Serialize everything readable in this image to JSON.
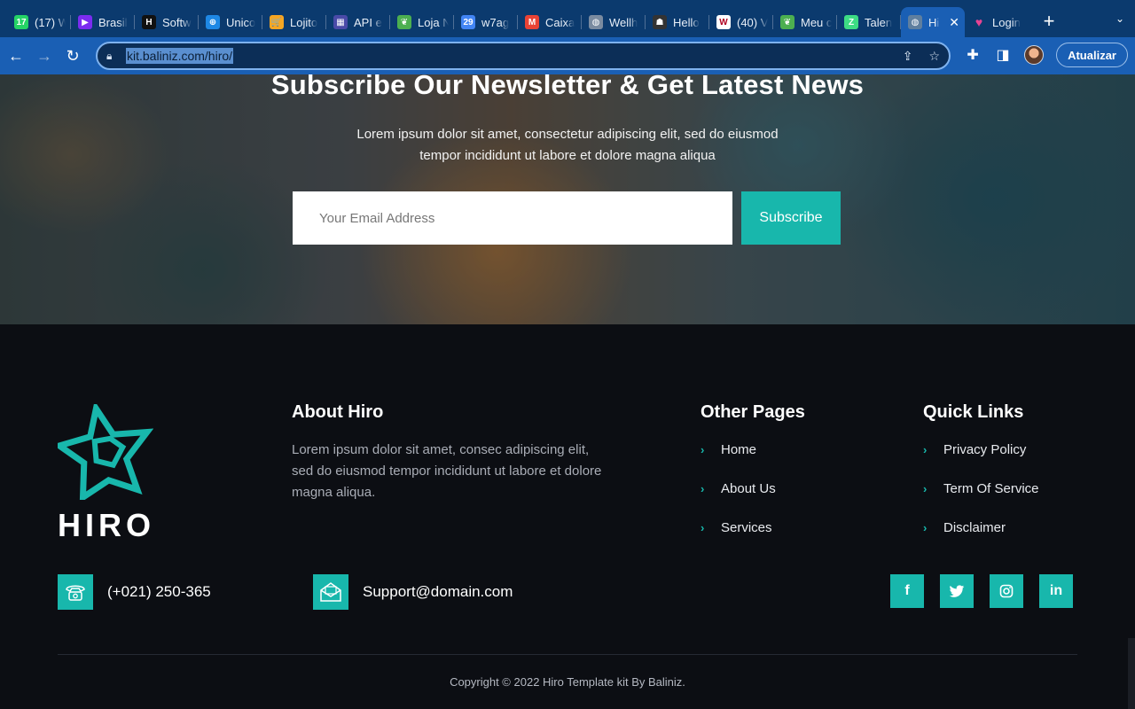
{
  "browser": {
    "tabs": [
      {
        "title": "(17) W",
        "icon": "whatsapp-icon",
        "color": "#25d366",
        "glyph": "17"
      },
      {
        "title": "Brasil",
        "icon": "play-arrow-icon",
        "color": "#7b2cf0",
        "glyph": "▶"
      },
      {
        "title": "Softw",
        "icon": "h-logo-icon",
        "color": "#111111",
        "glyph": "H"
      },
      {
        "title": "Unico",
        "icon": "target-icon",
        "color": "#1e88e5",
        "glyph": "⊕"
      },
      {
        "title": "Lojito",
        "icon": "cart-icon",
        "color": "#f5a623",
        "glyph": "🛒"
      },
      {
        "title": "API e",
        "icon": "city-icon",
        "color": "#4a4aa8",
        "glyph": "▦"
      },
      {
        "title": "Loja N",
        "icon": "leaf-icon",
        "color": "#4caf50",
        "glyph": "❦"
      },
      {
        "title": "w7ag",
        "icon": "calendar-icon",
        "color": "#4285f4",
        "glyph": "29"
      },
      {
        "title": "Caixa",
        "icon": "gmail-icon",
        "color": "#ea4335",
        "glyph": "M"
      },
      {
        "title": "Wellh",
        "icon": "globe-icon",
        "color": "#7a8ba0",
        "glyph": "◍"
      },
      {
        "title": "Hello",
        "icon": "person-icon",
        "color": "#333333",
        "glyph": "☗"
      },
      {
        "title": "(40) V",
        "icon": "w-logo-icon",
        "color": "#ffffff",
        "glyph": "W"
      },
      {
        "title": "Meu c",
        "icon": "leaf-icon",
        "color": "#4caf50",
        "glyph": "❦"
      },
      {
        "title": "Talen",
        "icon": "z-logo-icon",
        "color": "#3ddc84",
        "glyph": "Z"
      }
    ],
    "active_tab": {
      "title": "Hi",
      "icon": "globe-icon",
      "close": "✕"
    },
    "login_tab": {
      "title": "Login",
      "icon": "heart-icon",
      "color": "#e84393"
    },
    "new_tab": "+",
    "url": "kit.baliniz.com/hiro/",
    "update_label": "Atualizar"
  },
  "newsletter": {
    "title": "Subscribe Our Newsletter & Get Latest News",
    "text": "Lorem ipsum dolor sit amet, consectetur adipiscing elit, sed do eiusmod tempor incididunt ut labore et dolore magna aliqua",
    "email_placeholder": "Your Email Address",
    "subscribe_label": "Subscribe"
  },
  "footer": {
    "logo_text": "HIRO",
    "about": {
      "title": "About Hiro",
      "text": "Lorem ipsum dolor sit amet, consec adipiscing elit, sed do eiusmod tempor incididunt ut labore et dolore magna aliqua."
    },
    "other_pages": {
      "title": "Other Pages",
      "items": [
        "Home",
        "About Us",
        "Services"
      ]
    },
    "quick_links": {
      "title": "Quick Links",
      "items": [
        "Privacy Policy",
        "Term Of Service",
        "Disclaimer"
      ]
    },
    "phone": "(+021) 250-365",
    "email": "Support@domain.com",
    "socials": [
      "facebook-icon",
      "twitter-icon",
      "instagram-icon",
      "linkedin-icon"
    ],
    "copyright": "Copyright © 2022 Hiro Template kit By Baliniz.",
    "accent_color": "#18b7ac"
  }
}
